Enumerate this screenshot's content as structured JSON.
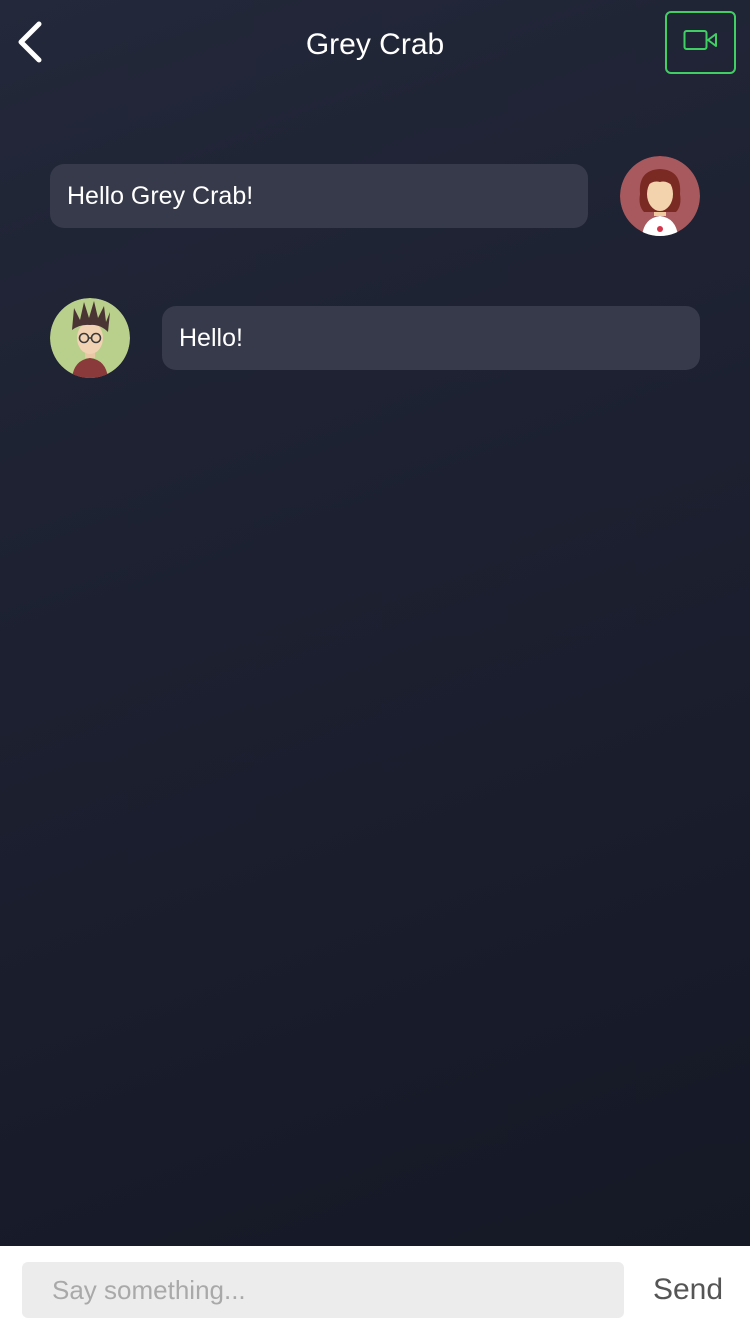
{
  "header": {
    "back_icon": "chevron-left-icon",
    "title": "Grey Crab",
    "video_icon": "video-camera-icon",
    "accent_color": "#3fcf63"
  },
  "messages": [
    {
      "sender": "self",
      "text": "Hello Grey Crab!",
      "avatar": "avatar-red-hair-icon"
    },
    {
      "sender": "other",
      "text": "Hello!",
      "avatar": "avatar-spiky-hair-icon"
    }
  ],
  "composer": {
    "placeholder": "Say something...",
    "value": "",
    "send_label": "Send"
  },
  "colors": {
    "background": "#1c2030",
    "bubble": "#363a4a"
  }
}
